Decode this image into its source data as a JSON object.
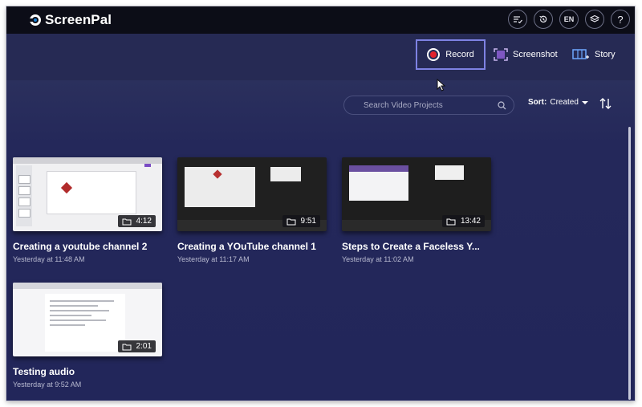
{
  "app": {
    "name": "ScreenPal",
    "brand_color": "#1a7fd1",
    "background": "#262a54"
  },
  "topbar": {
    "buttons": [
      {
        "icon": "checklist-icon"
      },
      {
        "icon": "history-icon"
      },
      {
        "label": "EN"
      },
      {
        "icon": "layers-icon"
      },
      {
        "label": "?"
      }
    ]
  },
  "toolbar": {
    "record_label": "Record",
    "screenshot_label": "Screenshot",
    "story_label": "Story",
    "record_color": "#e3232d",
    "highlight_color": "#7e82e3"
  },
  "search": {
    "placeholder": "Search Video Projects",
    "value": ""
  },
  "sort": {
    "label": "Sort:",
    "value": "Created"
  },
  "projects": [
    {
      "title": "Creating a youtube channel 2",
      "date": "Yesterday at 11:48 AM",
      "duration": "4:12"
    },
    {
      "title": "Creating a YOuTube channel 1",
      "date": "Yesterday at 11:17 AM",
      "duration": "9:51"
    },
    {
      "title": "Steps to Create a Faceless Y...",
      "date": "Yesterday at 11:02 AM",
      "duration": "13:42"
    },
    {
      "title": "Testing audio",
      "date": "Yesterday at 9:52 AM",
      "duration": "2:01"
    }
  ]
}
